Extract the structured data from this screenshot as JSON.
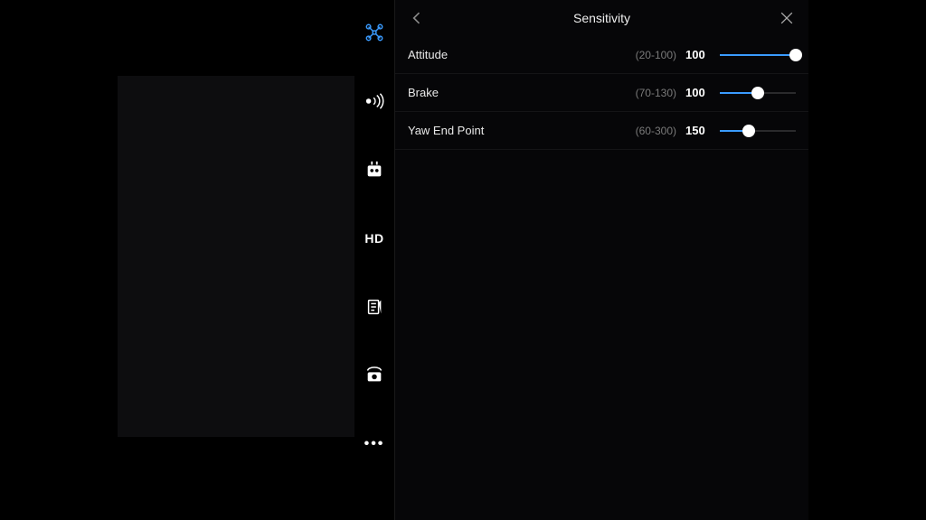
{
  "header": {
    "title": "Sensitivity"
  },
  "nav": {
    "items": [
      {
        "name": "drone-icon",
        "active": true
      },
      {
        "name": "signal-icon"
      },
      {
        "name": "controller-icon"
      },
      {
        "name": "hd-icon",
        "label": "HD"
      },
      {
        "name": "battery-icon"
      },
      {
        "name": "gimbal-icon"
      },
      {
        "name": "more-icon"
      }
    ]
  },
  "settings": [
    {
      "label": "Attitude",
      "range": "(20-100)",
      "value": "100",
      "min": 20,
      "max": 100,
      "current": 100
    },
    {
      "label": "Brake",
      "range": "(70-130)",
      "value": "100",
      "min": 70,
      "max": 130,
      "current": 100
    },
    {
      "label": "Yaw End Point",
      "range": "(60-300)",
      "value": "150",
      "min": 60,
      "max": 300,
      "current": 150
    }
  ],
  "colors": {
    "accent": "#3a9bff"
  }
}
